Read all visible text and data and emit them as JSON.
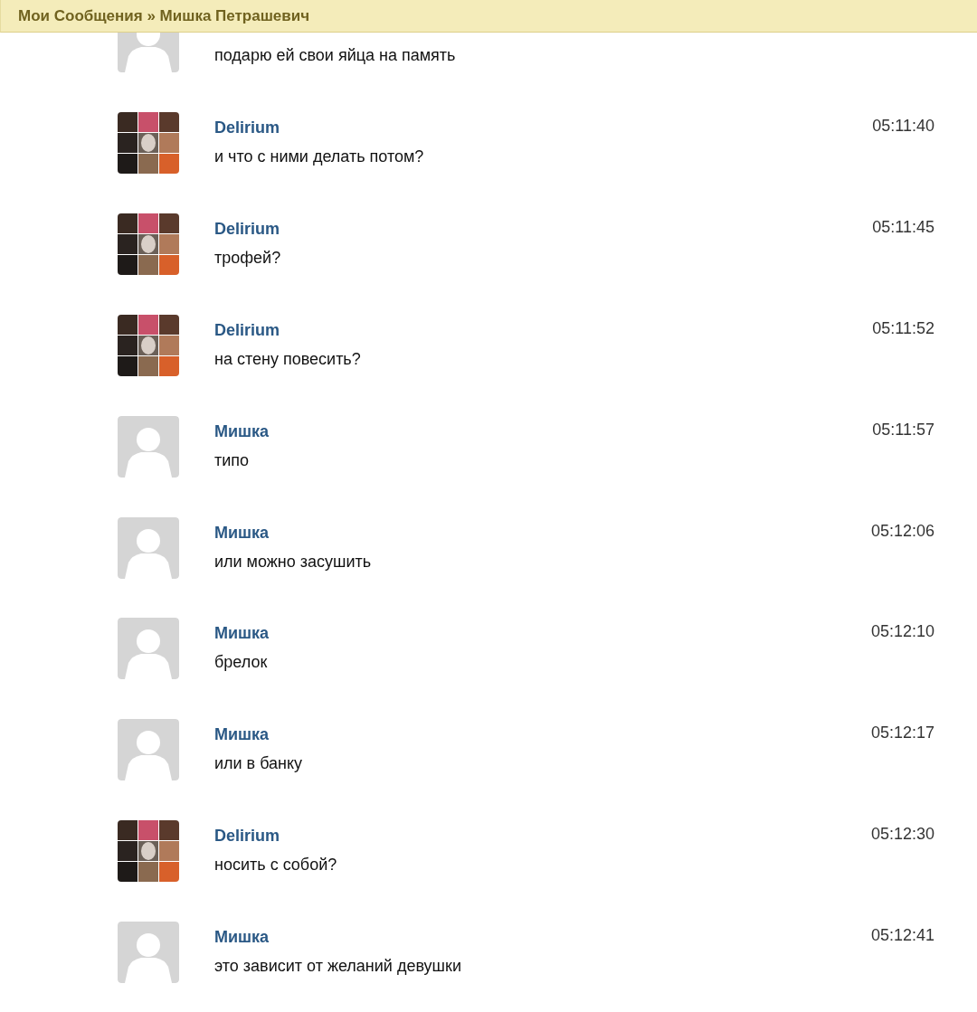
{
  "header": {
    "title": "Мои Сообщения » Мишка Петрашевич"
  },
  "messages": [
    {
      "kind": "default",
      "text": "подарю ей свои яйца на память"
    },
    {
      "kind": "picture",
      "name": "Delirium",
      "time": "05:11:40",
      "text": "и что с ними делать потом?"
    },
    {
      "kind": "picture",
      "name": "Delirium",
      "time": "05:11:45",
      "text": "трофей?"
    },
    {
      "kind": "picture",
      "name": "Delirium",
      "time": "05:11:52",
      "text": "на стену повесить?"
    },
    {
      "kind": "default",
      "name": "Мишка",
      "time": "05:11:57",
      "text": "типо"
    },
    {
      "kind": "default",
      "name": "Мишка",
      "time": "05:12:06",
      "text": "или можно засушить"
    },
    {
      "kind": "default",
      "name": "Мишка",
      "time": "05:12:10",
      "text": "брелок"
    },
    {
      "kind": "default",
      "name": "Мишка",
      "time": "05:12:17",
      "text": "или в банку"
    },
    {
      "kind": "picture",
      "name": "Delirium",
      "time": "05:12:30",
      "text": "носить с собой?"
    },
    {
      "kind": "default",
      "name": "Мишка",
      "time": "05:12:41",
      "text": "это зависит от желаний девушки"
    }
  ]
}
